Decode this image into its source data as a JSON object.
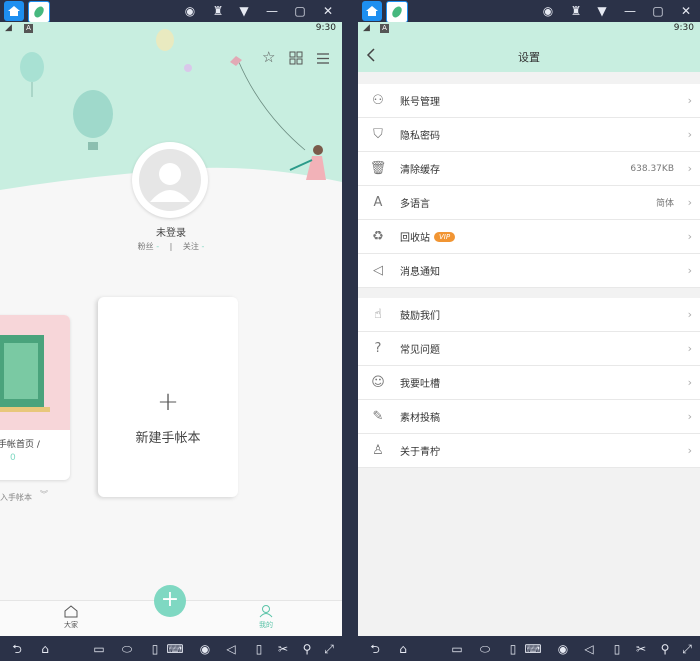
{
  "left_panel": {
    "time": "9:30",
    "profile": {
      "name": "未登录",
      "fans_label": "粉丝",
      "fans_value": "-",
      "separator": "|",
      "follow_label": "关注",
      "follow_value": "-"
    },
    "notebook_card": {
      "title": "手帐首页 /",
      "count": "0"
    },
    "notebook_caption": "入手帐本",
    "new_notebook": {
      "plus": "+",
      "label": "新建手帐本"
    },
    "nav": {
      "home": "大家",
      "me": "我的"
    }
  },
  "right_panel": {
    "time": "9:30",
    "title": "设置",
    "group1": [
      {
        "label": "账号管理",
        "icon": "user-gear-icon",
        "value": ""
      },
      {
        "label": "隐私密码",
        "icon": "shield-lock-icon",
        "value": ""
      },
      {
        "label": "清除缓存",
        "icon": "trash-icon",
        "value": "638.37KB"
      },
      {
        "label": "多语言",
        "icon": "language-icon",
        "value": "简体"
      },
      {
        "label": "回收站",
        "icon": "recycle-bin-icon",
        "value": "",
        "badge": "VIP"
      },
      {
        "label": "消息通知",
        "icon": "speaker-icon",
        "value": ""
      }
    ],
    "group2": [
      {
        "label": "鼓励我们",
        "icon": "thumbs-up-icon",
        "value": ""
      },
      {
        "label": "常见问题",
        "icon": "question-icon",
        "value": ""
      },
      {
        "label": "我要吐槽",
        "icon": "chat-bubble-icon",
        "value": ""
      },
      {
        "label": "素材投稿",
        "icon": "edit-icon",
        "value": ""
      },
      {
        "label": "关于青柠",
        "icon": "person-icon",
        "value": ""
      }
    ]
  },
  "colors": {
    "mint": "#c8eee0",
    "accent": "#7fd8c2",
    "vip": "#f19533",
    "dark_bar": "#2b3248"
  }
}
